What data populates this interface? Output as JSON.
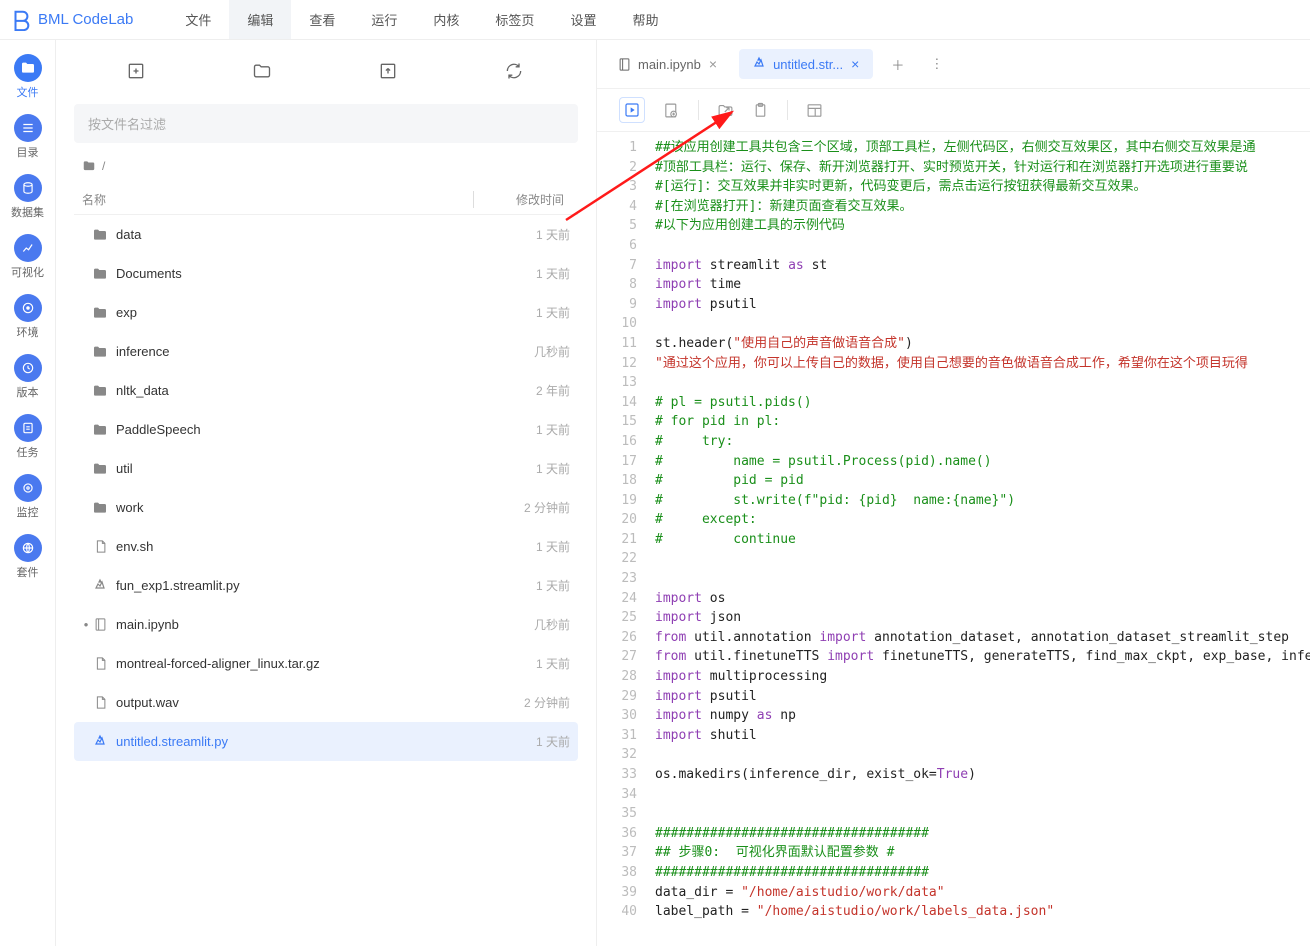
{
  "brand": "BML CodeLab",
  "menu": [
    "文件",
    "编辑",
    "查看",
    "运行",
    "内核",
    "标签页",
    "设置",
    "帮助"
  ],
  "menu_active_index": 1,
  "rail": [
    {
      "label": "文件",
      "icon": "folder",
      "selected": true
    },
    {
      "label": "目录",
      "icon": "list"
    },
    {
      "label": "数据集",
      "icon": "db"
    },
    {
      "label": "可视化",
      "icon": "chart"
    },
    {
      "label": "环境",
      "icon": "disc"
    },
    {
      "label": "版本",
      "icon": "clock"
    },
    {
      "label": "任务",
      "icon": "task"
    },
    {
      "label": "监控",
      "icon": "target"
    },
    {
      "label": "套件",
      "icon": "globe"
    }
  ],
  "filter_placeholder": "按文件名过滤",
  "breadcrumb_icon": "folder",
  "breadcrumb_path": "/",
  "table": {
    "col_name": "名称",
    "col_time": "修改时间"
  },
  "files": [
    {
      "icon": "folder",
      "name": "data",
      "time": "1 天前"
    },
    {
      "icon": "folder",
      "name": "Documents",
      "time": "1 天前"
    },
    {
      "icon": "folder",
      "name": "exp",
      "time": "1 天前"
    },
    {
      "icon": "folder",
      "name": "inference",
      "time": "几秒前"
    },
    {
      "icon": "folder",
      "name": "nltk_data",
      "time": "2 年前"
    },
    {
      "icon": "folder",
      "name": "PaddleSpeech",
      "time": "1 天前"
    },
    {
      "icon": "folder",
      "name": "util",
      "time": "1 天前"
    },
    {
      "icon": "folder",
      "name": "work",
      "time": "2 分钟前"
    },
    {
      "icon": "file",
      "name": "env.sh",
      "time": "1 天前"
    },
    {
      "icon": "streamlit",
      "name": "fun_exp1.streamlit.py",
      "time": "1 天前"
    },
    {
      "icon": "notebook",
      "name": "main.ipynb",
      "time": "几秒前",
      "running": true
    },
    {
      "icon": "file",
      "name": "montreal-forced-aligner_linux.tar.gz",
      "time": "1 天前"
    },
    {
      "icon": "file",
      "name": "output.wav",
      "time": "2 分钟前"
    },
    {
      "icon": "streamlit",
      "name": "untitled.streamlit.py",
      "time": "1 天前",
      "selected": true
    }
  ],
  "tabs": [
    {
      "icon": "notebook",
      "label": "main.ipynb",
      "active": false
    },
    {
      "icon": "streamlit",
      "label": "untitled.str...",
      "active": true
    }
  ],
  "code": {
    "lines": [
      {
        "n": 1,
        "segs": [
          {
            "t": "##",
            "c": "green"
          },
          {
            "t": "该应用创建工具共包含三个区域，顶部工具栏，左侧代码区，右侧交互效果区，其中右侧交互效果是通",
            "c": "green"
          }
        ]
      },
      {
        "n": 2,
        "segs": [
          {
            "t": "#顶部工具栏：运行、保存、新开浏览器打开、实时预览开关，针对运行和在浏览器打开选项进行重要说",
            "c": "green"
          }
        ]
      },
      {
        "n": 3,
        "segs": [
          {
            "t": "#[运行]：交互效果并非实时更新，代码变更后，需点击运行按钮获得最新交互效果。",
            "c": "green"
          }
        ]
      },
      {
        "n": 4,
        "segs": [
          {
            "t": "#[在浏览器打开]：新建页面查看交互效果。",
            "c": "green"
          }
        ]
      },
      {
        "n": 5,
        "segs": [
          {
            "t": "#以下为应用创建工具的示例代码",
            "c": "green"
          }
        ]
      },
      {
        "n": 6,
        "segs": [
          {
            "t": "",
            "c": "black"
          }
        ]
      },
      {
        "n": 7,
        "segs": [
          {
            "t": "import ",
            "c": "purple"
          },
          {
            "t": "streamlit ",
            "c": "black"
          },
          {
            "t": "as ",
            "c": "purple"
          },
          {
            "t": "st",
            "c": "black"
          }
        ]
      },
      {
        "n": 8,
        "segs": [
          {
            "t": "import ",
            "c": "purple"
          },
          {
            "t": "time",
            "c": "black"
          }
        ]
      },
      {
        "n": 9,
        "segs": [
          {
            "t": "import ",
            "c": "purple"
          },
          {
            "t": "psutil",
            "c": "black"
          }
        ]
      },
      {
        "n": 10,
        "segs": [
          {
            "t": "",
            "c": "black"
          }
        ]
      },
      {
        "n": 11,
        "segs": [
          {
            "t": "st.header(",
            "c": "black"
          },
          {
            "t": "\"使用自己的声音做语音合成\"",
            "c": "red"
          },
          {
            "t": ")",
            "c": "black"
          }
        ]
      },
      {
        "n": 12,
        "segs": [
          {
            "t": "\"通过这个应用，你可以上传自己的数据，使用自己想要的音色做语音合成工作，希望你在这个项目玩得",
            "c": "red"
          }
        ]
      },
      {
        "n": 13,
        "segs": [
          {
            "t": "",
            "c": "black"
          }
        ]
      },
      {
        "n": 14,
        "segs": [
          {
            "t": "# pl = psutil.pids()",
            "c": "green"
          }
        ]
      },
      {
        "n": 15,
        "segs": [
          {
            "t": "# for pid in pl:",
            "c": "green"
          }
        ]
      },
      {
        "n": 16,
        "segs": [
          {
            "t": "#     try:",
            "c": "green"
          }
        ]
      },
      {
        "n": 17,
        "segs": [
          {
            "t": "#         name = psutil.Process(pid).name()",
            "c": "green"
          }
        ]
      },
      {
        "n": 18,
        "segs": [
          {
            "t": "#         pid = pid",
            "c": "green"
          }
        ]
      },
      {
        "n": 19,
        "segs": [
          {
            "t": "#         st.write(f\"pid: {pid}  name:{name}\")",
            "c": "green"
          }
        ]
      },
      {
        "n": 20,
        "segs": [
          {
            "t": "#     except:",
            "c": "green"
          }
        ]
      },
      {
        "n": 21,
        "segs": [
          {
            "t": "#         continue",
            "c": "green"
          }
        ]
      },
      {
        "n": 22,
        "segs": [
          {
            "t": "",
            "c": "black"
          }
        ]
      },
      {
        "n": 23,
        "segs": [
          {
            "t": "",
            "c": "black"
          }
        ]
      },
      {
        "n": 24,
        "segs": [
          {
            "t": "import ",
            "c": "purple"
          },
          {
            "t": "os",
            "c": "black"
          }
        ]
      },
      {
        "n": 25,
        "segs": [
          {
            "t": "import ",
            "c": "purple"
          },
          {
            "t": "json",
            "c": "black"
          }
        ]
      },
      {
        "n": 26,
        "segs": [
          {
            "t": "from ",
            "c": "purple"
          },
          {
            "t": "util.annotation ",
            "c": "black"
          },
          {
            "t": "import ",
            "c": "purple"
          },
          {
            "t": "annotation_dataset, annotation_dataset_streamlit_step",
            "c": "black"
          }
        ]
      },
      {
        "n": 27,
        "segs": [
          {
            "t": "from ",
            "c": "purple"
          },
          {
            "t": "util.finetuneTTS ",
            "c": "black"
          },
          {
            "t": "import ",
            "c": "purple"
          },
          {
            "t": "finetuneTTS, generateTTS, find_max_ckpt, exp_base, inferenc",
            "c": "black"
          }
        ]
      },
      {
        "n": 28,
        "segs": [
          {
            "t": "import ",
            "c": "purple"
          },
          {
            "t": "multiprocessing",
            "c": "black"
          }
        ]
      },
      {
        "n": 29,
        "segs": [
          {
            "t": "import ",
            "c": "purple"
          },
          {
            "t": "psutil",
            "c": "black"
          }
        ]
      },
      {
        "n": 30,
        "segs": [
          {
            "t": "import ",
            "c": "purple"
          },
          {
            "t": "numpy ",
            "c": "black"
          },
          {
            "t": "as ",
            "c": "purple"
          },
          {
            "t": "np",
            "c": "black"
          }
        ]
      },
      {
        "n": 31,
        "segs": [
          {
            "t": "import ",
            "c": "purple"
          },
          {
            "t": "shutil",
            "c": "black"
          }
        ]
      },
      {
        "n": 32,
        "segs": [
          {
            "t": "",
            "c": "black"
          }
        ]
      },
      {
        "n": 33,
        "segs": [
          {
            "t": "os.makedirs(inference_dir, exist_ok=",
            "c": "black"
          },
          {
            "t": "True",
            "c": "purple"
          },
          {
            "t": ")",
            "c": "black"
          }
        ]
      },
      {
        "n": 34,
        "segs": [
          {
            "t": "",
            "c": "black"
          }
        ]
      },
      {
        "n": 35,
        "segs": [
          {
            "t": "",
            "c": "black"
          }
        ]
      },
      {
        "n": 36,
        "segs": [
          {
            "t": "###################################",
            "c": "green"
          }
        ]
      },
      {
        "n": 37,
        "segs": [
          {
            "t": "## 步骤0:  可视化界面默认配置参数 #",
            "c": "green"
          }
        ]
      },
      {
        "n": 38,
        "segs": [
          {
            "t": "###################################",
            "c": "green"
          }
        ]
      },
      {
        "n": 39,
        "segs": [
          {
            "t": "data_dir = ",
            "c": "black"
          },
          {
            "t": "\"/home/aistudio/work/data\"",
            "c": "red"
          }
        ]
      },
      {
        "n": 40,
        "segs": [
          {
            "t": "label_path = ",
            "c": "black"
          },
          {
            "t": "\"/home/aistudio/work/labels_data.json\"",
            "c": "red"
          }
        ]
      }
    ]
  }
}
